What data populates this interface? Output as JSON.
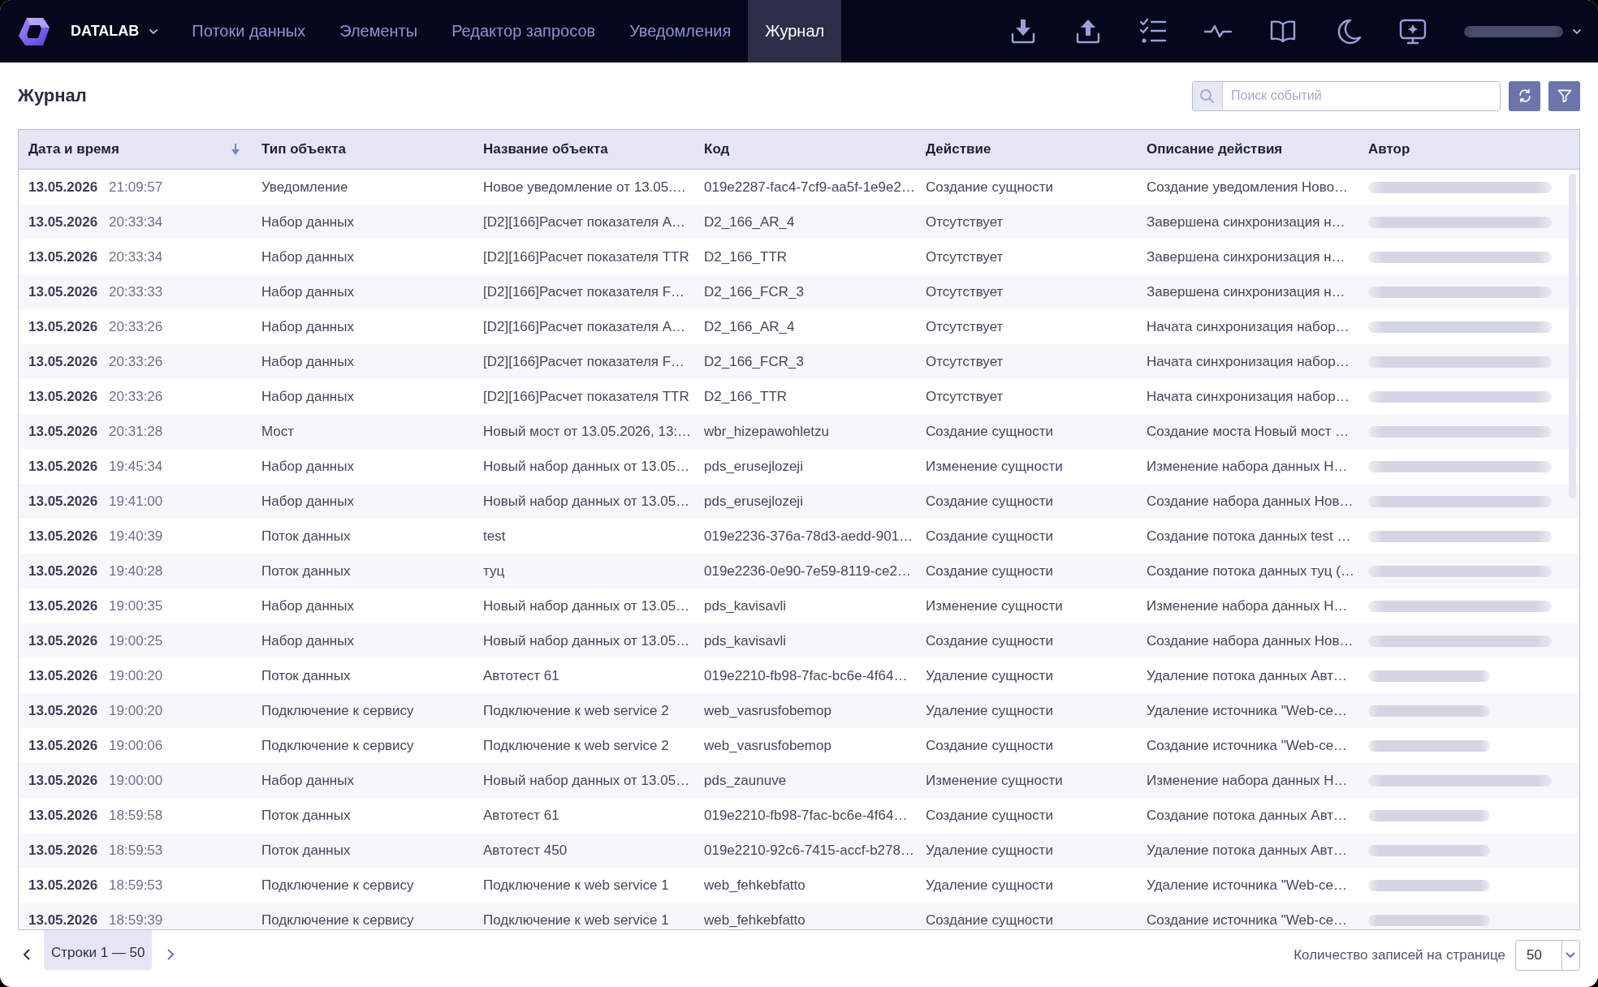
{
  "navbar": {
    "brand": "DATALAB",
    "tabs": [
      {
        "label": "Потоки данных",
        "selected": false
      },
      {
        "label": "Элементы",
        "selected": false
      },
      {
        "label": "Редактор запросов",
        "selected": false
      },
      {
        "label": "Уведомления",
        "selected": false
      },
      {
        "label": "Журнал",
        "selected": true
      }
    ],
    "user": {
      "redacted": true
    }
  },
  "page": {
    "title": "Журнал",
    "search": {
      "placeholder": "Поиск событий"
    }
  },
  "table": {
    "columns": [
      {
        "label": "Дата и время",
        "sorted": true
      },
      {
        "label": "Тип объекта",
        "sorted": false
      },
      {
        "label": "Название объекта",
        "sorted": false
      },
      {
        "label": "Код",
        "sorted": false
      },
      {
        "label": "Действие",
        "sorted": false
      },
      {
        "label": "Описание действия",
        "sorted": false
      },
      {
        "label": "Автор",
        "sorted": false
      }
    ],
    "rows": [
      {
        "date": "13.05.2026",
        "time": "21:09:57",
        "object_type": "Уведомление",
        "object_name": "Новое уведомление от 13.05.…",
        "code": "019e2287-fac4-7cf9-aa5f-1e9e2…",
        "action": "Создание сущности",
        "action_description": "Создание уведомления Ново…",
        "author_redacted": true,
        "author_short": false
      },
      {
        "date": "13.05.2026",
        "time": "20:33:34",
        "object_type": "Набор данных",
        "object_name": "[D2][166]Расчет показателя A…",
        "code": "D2_166_AR_4",
        "action": "Отсутствует",
        "action_description": "Завершена синхронизация н…",
        "author_redacted": true,
        "author_short": false
      },
      {
        "date": "13.05.2026",
        "time": "20:33:34",
        "object_type": "Набор данных",
        "object_name": "[D2][166]Расчет показателя TTR",
        "code": "D2_166_TTR",
        "action": "Отсутствует",
        "action_description": "Завершена синхронизация н…",
        "author_redacted": true,
        "author_short": false
      },
      {
        "date": "13.05.2026",
        "time": "20:33:33",
        "object_type": "Набор данных",
        "object_name": "[D2][166]Расчет показателя F…",
        "code": "D2_166_FCR_3",
        "action": "Отсутствует",
        "action_description": "Завершена синхронизация н…",
        "author_redacted": true,
        "author_short": false
      },
      {
        "date": "13.05.2026",
        "time": "20:33:26",
        "object_type": "Набор данных",
        "object_name": "[D2][166]Расчет показателя A…",
        "code": "D2_166_AR_4",
        "action": "Отсутствует",
        "action_description": "Начата синхронизация набор…",
        "author_redacted": true,
        "author_short": false
      },
      {
        "date": "13.05.2026",
        "time": "20:33:26",
        "object_type": "Набор данных",
        "object_name": "[D2][166]Расчет показателя F…",
        "code": "D2_166_FCR_3",
        "action": "Отсутствует",
        "action_description": "Начата синхронизация набор…",
        "author_redacted": true,
        "author_short": false
      },
      {
        "date": "13.05.2026",
        "time": "20:33:26",
        "object_type": "Набор данных",
        "object_name": "[D2][166]Расчет показателя TTR",
        "code": "D2_166_TTR",
        "action": "Отсутствует",
        "action_description": "Начата синхронизация набор…",
        "author_redacted": true,
        "author_short": false
      },
      {
        "date": "13.05.2026",
        "time": "20:31:28",
        "object_type": "Мост",
        "object_name": "Новый мост от 13.05.2026, 13:…",
        "code": "wbr_hizepawohletzu",
        "action": "Создание сущности",
        "action_description": "Создание моста Новый мост …",
        "author_redacted": true,
        "author_short": false
      },
      {
        "date": "13.05.2026",
        "time": "19:45:34",
        "object_type": "Набор данных",
        "object_name": "Новый набор данных от 13.05…",
        "code": "pds_erusejlozeji",
        "action": "Изменение сущности",
        "action_description": "Изменение набора данных Н…",
        "author_redacted": true,
        "author_short": false
      },
      {
        "date": "13.05.2026",
        "time": "19:41:00",
        "object_type": "Набор данных",
        "object_name": "Новый набор данных от 13.05…",
        "code": "pds_erusejlozeji",
        "action": "Создание сущности",
        "action_description": "Создание набора данных Нов…",
        "author_redacted": true,
        "author_short": false
      },
      {
        "date": "13.05.2026",
        "time": "19:40:39",
        "object_type": "Поток данных",
        "object_name": "test",
        "code": "019e2236-376a-78d3-aedd-901…",
        "action": "Создание сущности",
        "action_description": "Создание потока данных test …",
        "author_redacted": true,
        "author_short": false
      },
      {
        "date": "13.05.2026",
        "time": "19:40:28",
        "object_type": "Поток данных",
        "object_name": "туц",
        "code": "019e2236-0e90-7e59-8119-ce2…",
        "action": "Создание сущности",
        "action_description": "Создание потока данных туц (…",
        "author_redacted": true,
        "author_short": false
      },
      {
        "date": "13.05.2026",
        "time": "19:00:35",
        "object_type": "Набор данных",
        "object_name": "Новый набор данных от 13.05…",
        "code": "pds_kavisavli",
        "action": "Изменение сущности",
        "action_description": "Изменение набора данных Н…",
        "author_redacted": true,
        "author_short": false
      },
      {
        "date": "13.05.2026",
        "time": "19:00:25",
        "object_type": "Набор данных",
        "object_name": "Новый набор данных от 13.05…",
        "code": "pds_kavisavli",
        "action": "Создание сущности",
        "action_description": "Создание набора данных Нов…",
        "author_redacted": true,
        "author_short": false
      },
      {
        "date": "13.05.2026",
        "time": "19:00:20",
        "object_type": "Поток данных",
        "object_name": "Автотест 61",
        "code": "019e2210-fb98-7fac-bc6e-4f64…",
        "action": "Удаление сущности",
        "action_description": "Удаление потока данных Авт…",
        "author_redacted": true,
        "author_short": true
      },
      {
        "date": "13.05.2026",
        "time": "19:00:20",
        "object_type": "Подключение к сервису",
        "object_name": "Подключение к web service 2",
        "code": "web_vasrusfobemop",
        "action": "Удаление сущности",
        "action_description": "Удаление источника \"Web-се…",
        "author_redacted": true,
        "author_short": true
      },
      {
        "date": "13.05.2026",
        "time": "19:00:06",
        "object_type": "Подключение к сервису",
        "object_name": "Подключение к web service 2",
        "code": "web_vasrusfobemop",
        "action": "Создание сущности",
        "action_description": "Создание источника \"Web-се…",
        "author_redacted": true,
        "author_short": true
      },
      {
        "date": "13.05.2026",
        "time": "19:00:00",
        "object_type": "Набор данных",
        "object_name": "Новый набор данных от 13.05…",
        "code": "pds_zaunuve",
        "action": "Изменение сущности",
        "action_description": "Изменение набора данных Н…",
        "author_redacted": true,
        "author_short": false
      },
      {
        "date": "13.05.2026",
        "time": "18:59:58",
        "object_type": "Поток данных",
        "object_name": "Автотест 61",
        "code": "019e2210-fb98-7fac-bc6e-4f64…",
        "action": "Создание сущности",
        "action_description": "Создание потока данных Авт…",
        "author_redacted": true,
        "author_short": true
      },
      {
        "date": "13.05.2026",
        "time": "18:59:53",
        "object_type": "Поток данных",
        "object_name": "Автотест 450",
        "code": "019e2210-92c6-7415-accf-b278…",
        "action": "Удаление сущности",
        "action_description": "Удаление потока данных Авт…",
        "author_redacted": true,
        "author_short": true
      },
      {
        "date": "13.05.2026",
        "time": "18:59:53",
        "object_type": "Подключение к сервису",
        "object_name": "Подключение к web service 1",
        "code": "web_fehkebfatto",
        "action": "Удаление сущности",
        "action_description": "Удаление источника \"Web-се…",
        "author_redacted": true,
        "author_short": true
      },
      {
        "date": "13.05.2026",
        "time": "18:59:39",
        "object_type": "Подключение к сервису",
        "object_name": "Подключение к web service 1",
        "code": "web_fehkebfatto",
        "action": "Создание сущности",
        "action_description": "Создание источника \"Web-се…",
        "author_redacted": true,
        "author_short": true
      }
    ]
  },
  "pagination": {
    "range": "Строки 1 — 50",
    "page_size_label": "Количество записей на странице",
    "page_size": "50"
  }
}
